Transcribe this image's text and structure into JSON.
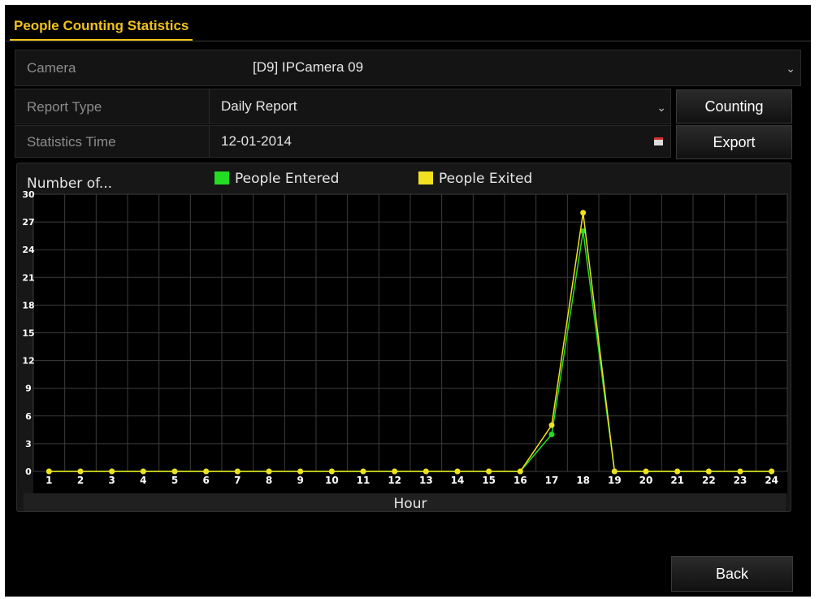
{
  "window": {
    "title": "People Counting Statistics"
  },
  "form": {
    "camera_label": "Camera",
    "camera_value": "[D9] IPCamera 09",
    "report_type_label": "Report Type",
    "report_type_value": "Daily Report",
    "statistics_time_label": "Statistics Time",
    "statistics_time_value": "12-01-2014"
  },
  "buttons": {
    "counting": "Counting",
    "export": "Export",
    "back": "Back"
  },
  "chart_data": {
    "type": "line",
    "ylabel": "Number of...",
    "xlabel": "Hour",
    "x": [
      1,
      2,
      3,
      4,
      5,
      6,
      7,
      8,
      9,
      10,
      11,
      12,
      13,
      14,
      15,
      16,
      17,
      18,
      19,
      20,
      21,
      22,
      23,
      24
    ],
    "ylim": [
      0,
      30
    ],
    "yticks": [
      0,
      3,
      6,
      9,
      12,
      15,
      18,
      21,
      24,
      27,
      30
    ],
    "grid": true,
    "legend_position": "top",
    "series": [
      {
        "name": "People Entered",
        "color": "#22dd22",
        "values": [
          0,
          0,
          0,
          0,
          0,
          0,
          0,
          0,
          0,
          0,
          0,
          0,
          0,
          0,
          0,
          0,
          4,
          26,
          0,
          0,
          0,
          0,
          0,
          0
        ]
      },
      {
        "name": "People Exited",
        "color": "#f0e020",
        "values": [
          0,
          0,
          0,
          0,
          0,
          0,
          0,
          0,
          0,
          0,
          0,
          0,
          0,
          0,
          0,
          0,
          5,
          28,
          0,
          0,
          0,
          0,
          0,
          0
        ]
      }
    ]
  }
}
